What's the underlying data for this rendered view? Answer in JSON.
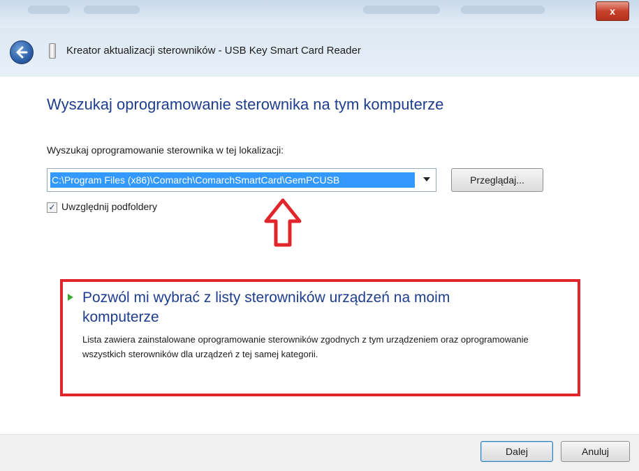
{
  "window": {
    "close_label": "x",
    "title": "Kreator aktualizacji sterowników - USB Key Smart Card Reader"
  },
  "page": {
    "heading": "Wyszukaj oprogramowanie sterownika na tym komputerze",
    "location_label": "Wyszukaj oprogramowanie sterownika w tej lokalizacji:",
    "location_value": "C:\\Program Files (x86)\\Comarch\\ComarchSmartCard\\GemPCUSB",
    "browse_label": "Przeglądaj...",
    "include_subfolders_label": "Uwzględnij podfoldery",
    "include_subfolders_checked": true
  },
  "option": {
    "title": "Pozwól mi wybrać z listy sterowników urządzeń na moim komputerze",
    "description": "Lista zawiera zainstalowane oprogramowanie sterowników zgodnych z tym urządzeniem oraz oprogramowanie wszystkich sterowników dla urządzeń z tej samej kategorii."
  },
  "footer": {
    "next_label": "Dalej",
    "cancel_label": "Anuluj"
  },
  "icons": {
    "back": "back-arrow-icon",
    "device": "usb-device-icon",
    "check": "checkmark-icon",
    "annotation": "red-up-arrow-icon",
    "bullet": "green-arrow-icon"
  },
  "colors": {
    "heading": "#1e3d8f",
    "selection": "#3399ff",
    "annotation_red": "#e0262a",
    "bullet_green": "#3aa82e"
  }
}
